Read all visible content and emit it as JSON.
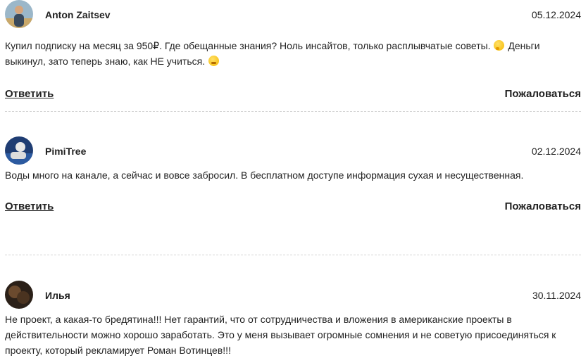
{
  "comments": [
    {
      "author": "Anton Zaitsev",
      "date": "05.12.2024",
      "text_parts": [
        "Купил подписку на месяц за 950₽. Где обещанные знания? Ноль инсайтов, только расплывчатые советы. ",
        " Деньги выкинул, зато теперь знаю, как НЕ учиться. "
      ],
      "emojis": [
        "thinking-face-icon",
        "tired-face-icon"
      ],
      "reply_label": "Ответить",
      "report_label": "Пожаловаться"
    },
    {
      "author": "PimiTree",
      "date": "02.12.2024",
      "text": "Воды много на канале, а сейчас и вовсе забросил. В бесплатном доступе информация сухая и несущественная.",
      "reply_label": "Ответить",
      "report_label": "Пожаловаться"
    },
    {
      "author": "Илья",
      "date": "30.11.2024",
      "text": "Не проект, а какая-то бредятина!!! Нет гарантий, что от сотрудничества и вложения в американские проекты в действительности можно хорошо заработать. Это у меня вызывает огромные сомнения и не советую присоединяться к проекту, который рекламирует Роман Вотинцев!!!"
    }
  ]
}
